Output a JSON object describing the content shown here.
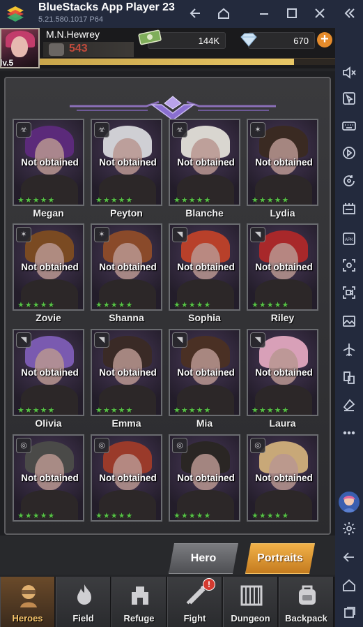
{
  "window": {
    "title": "BlueStacks App Player 23",
    "version": "5.21.580.1017  P64"
  },
  "player": {
    "name": "M.N.Hewrey",
    "level": "lv.5",
    "power": "543",
    "exp_fraction": 0.86
  },
  "resources": {
    "cash": "144K",
    "diamonds": "670"
  },
  "heroes": [
    {
      "name": "Megan",
      "status": "Not obtained",
      "stars": 5,
      "hair": "#5b2a7a",
      "badge": "bio"
    },
    {
      "name": "Peyton",
      "status": "Not obtained",
      "stars": 5,
      "hair": "#cfcfd4",
      "badge": "bio"
    },
    {
      "name": "Blanche",
      "status": "Not obtained",
      "stars": 5,
      "hair": "#d9d6d0",
      "badge": "bio"
    },
    {
      "name": "Lydia",
      "status": "Not obtained",
      "stars": 5,
      "hair": "#3a2a22",
      "badge": "crest"
    },
    {
      "name": "Zovie",
      "status": "Not obtained",
      "stars": 5,
      "hair": "#7a4a22",
      "badge": "crest"
    },
    {
      "name": "Shanna",
      "status": "Not obtained",
      "stars": 5,
      "hair": "#8a4a2a",
      "badge": "crest"
    },
    {
      "name": "Sophia",
      "status": "Not obtained",
      "stars": 5,
      "hair": "#b8402a",
      "badge": "arrow"
    },
    {
      "name": "Riley",
      "status": "Not obtained",
      "stars": 5,
      "hair": "#a8282a",
      "badge": "arrow"
    },
    {
      "name": "Olivia",
      "status": "Not obtained",
      "stars": 5,
      "hair": "#7a5ab0",
      "badge": "arrow"
    },
    {
      "name": "Emma",
      "status": "Not obtained",
      "stars": 5,
      "hair": "#3a2a26",
      "badge": "arrow"
    },
    {
      "name": "Mia",
      "status": "Not obtained",
      "stars": 5,
      "hair": "#4a3024",
      "badge": "arrow"
    },
    {
      "name": "Laura",
      "status": "Not obtained",
      "stars": 5,
      "hair": "#d8a0b8",
      "badge": "arrow"
    },
    {
      "name": "",
      "status": "Not obtained",
      "stars": 5,
      "hair": "#4a4a48",
      "badge": "shield"
    },
    {
      "name": "",
      "status": "Not obtained",
      "stars": 5,
      "hair": "#9a3a2a",
      "badge": "shield"
    },
    {
      "name": "",
      "status": "Not obtained",
      "stars": 5,
      "hair": "#2a2624",
      "badge": "shield"
    },
    {
      "name": "",
      "status": "Not obtained",
      "stars": 5,
      "hair": "#c8a878",
      "badge": "shield"
    }
  ],
  "tabs": {
    "hero": "Hero",
    "portraits": "Portraits",
    "active": "portraits"
  },
  "nav": [
    {
      "label": "Heroes",
      "icon": "hero-mask-icon",
      "active": true
    },
    {
      "label": "Field",
      "icon": "field-fire-icon",
      "active": false
    },
    {
      "label": "Refuge",
      "icon": "refuge-building-icon",
      "active": false
    },
    {
      "label": "Fight",
      "icon": "fight-weapons-icon",
      "active": false,
      "notification": "!"
    },
    {
      "label": "Dungeon",
      "icon": "dungeon-gate-icon",
      "active": false
    },
    {
      "label": "Backpack",
      "icon": "backpack-icon",
      "active": false
    }
  ],
  "sidebar_icons": [
    "volume-icon",
    "cursor-icon",
    "keyboard-icon",
    "macro-icon",
    "rotate-icon",
    "performance-icon",
    "apk-icon",
    "screenshot-icon",
    "record-icon",
    "media-folder-icon",
    "airplane-icon",
    "multi-instance-icon",
    "eco-mode-icon",
    "more-icon",
    "assistant-avatar-icon",
    "settings-icon",
    "back-icon",
    "home-icon",
    "recents-icon"
  ],
  "colors": {
    "accent_gold": "#f1b149",
    "star_green": "#57c246",
    "power_red": "#c14a3b"
  }
}
